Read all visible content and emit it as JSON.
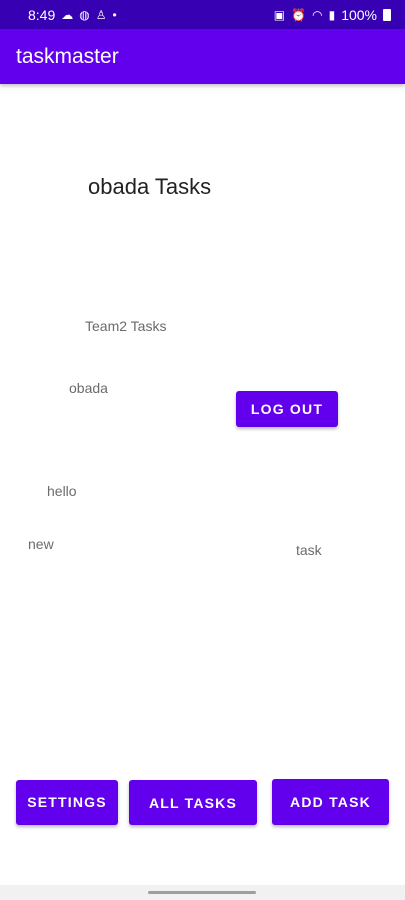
{
  "status_bar": {
    "time": "8:49",
    "battery": "100%",
    "left_icons": [
      "cloud-icon",
      "globe-icon",
      "person-icon",
      "dot-icon"
    ],
    "right_icons": [
      "lock-icon",
      "alarm-icon",
      "wifi-icon",
      "signal-icon",
      "battery-icon"
    ]
  },
  "app_bar": {
    "title": "taskmaster"
  },
  "main": {
    "heading": "obada Tasks",
    "team_label": "Team2 Tasks",
    "user_label": "obada",
    "logout_button": "Log Out",
    "tasks": [
      "hello",
      "new",
      "task"
    ]
  },
  "bottom_buttons": {
    "settings": "Settings",
    "all_tasks": "All Tasks",
    "add_task": "Add Task"
  },
  "colors": {
    "status_bar": "#3700b3",
    "primary": "#6200ee",
    "text_secondary": "#6b6b6b",
    "text_primary": "#222222"
  }
}
